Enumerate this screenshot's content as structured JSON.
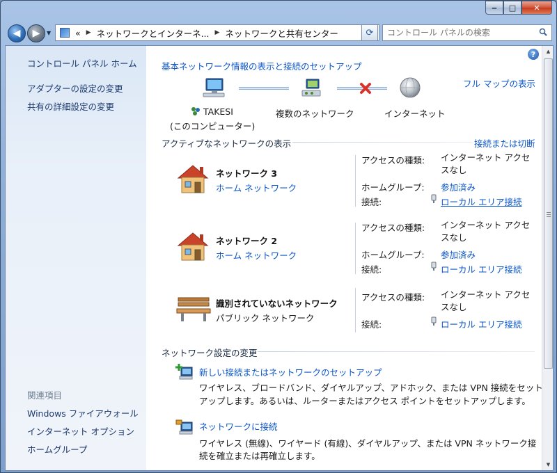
{
  "window": {
    "minimize_label": "‒",
    "maximize_label": "□",
    "close_label": "✕"
  },
  "nav": {
    "breadcrumb_prefix": "«",
    "breadcrumb": [
      "ネットワークとインターネ...",
      "ネットワークと共有センター"
    ],
    "search_placeholder": "コントロール パネルの検索"
  },
  "sidebar": {
    "home": "コントロール パネル ホーム",
    "items": [
      "アダプターの設定の変更",
      "共有の詳細設定の変更"
    ],
    "related_heading": "関連項目",
    "related": [
      "Windows ファイアウォール",
      "インターネット オプション",
      "ホームグループ"
    ]
  },
  "main": {
    "title": "基本ネットワーク情報の表示と接続のセットアップ",
    "full_map": "フル マップの表示",
    "map": {
      "computer_name": "TAKESI",
      "computer_sub": "(このコンピューター)",
      "middle": "複数のネットワーク",
      "internet": "インターネット"
    },
    "active_heading": "アクティブなネットワークの表示",
    "connect_disconnect": "接続または切断",
    "labels": {
      "access_type": "アクセスの種類:",
      "homegroup": "ホームグループ:",
      "connection": "接続:"
    },
    "networks": [
      {
        "name": "ネットワーク 3",
        "type": "ホーム ネットワーク",
        "access_line1": "インターネット アクセ",
        "access_line2": "スなし",
        "homegroup": "参加済み",
        "connection": "ローカル エリア接続"
      },
      {
        "name": "ネットワーク 2",
        "type": "ホーム ネットワーク",
        "access_line1": "インターネット アクセ",
        "access_line2": "スなし",
        "homegroup": "参加済み",
        "connection": "ローカル エリア接続"
      },
      {
        "name": "識別されていないネットワーク",
        "type": "パブリック ネットワーク",
        "access_line1": "インターネット アクセ",
        "access_line2": "スなし",
        "connection": "ローカル エリア接続"
      }
    ],
    "change_heading": "ネットワーク設定の変更",
    "tasks": [
      {
        "title": "新しい接続またはネットワークのセットアップ",
        "desc1": "ワイヤレス、ブロードバンド、ダイヤルアップ、アドホック、または VPN 接続をセット",
        "desc2": "アップします。あるいは、ルーターまたはアクセス ポイントをセットアップします。"
      },
      {
        "title": "ネットワークに接続",
        "desc1": "ワイヤレス (無線)、ワイヤード (有線)、ダイヤルアップ、または VPN ネットワーク接",
        "desc2": "続を確立または再確立します。"
      }
    ]
  }
}
